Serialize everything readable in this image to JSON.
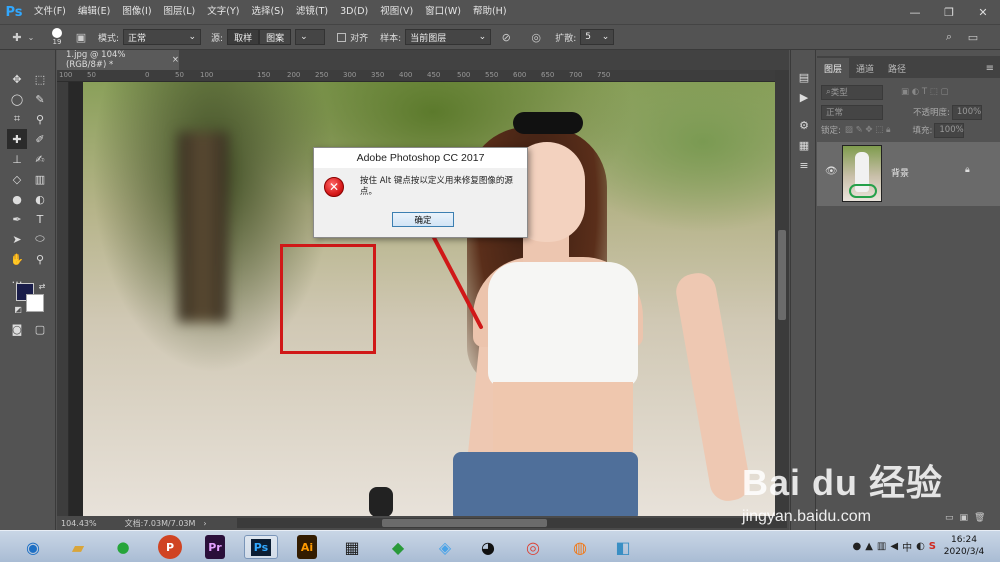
{
  "app": {
    "logo": "Ps"
  },
  "menu": [
    "文件(F)",
    "编辑(E)",
    "图像(I)",
    "图层(L)",
    "文字(Y)",
    "选择(S)",
    "滤镜(T)",
    "3D(D)",
    "视图(V)",
    "窗口(W)",
    "帮助(H)"
  ],
  "window_controls": {
    "minimize": "—",
    "maximize": "❐",
    "close": "✕"
  },
  "options": {
    "brush_size": "19",
    "mode_label": "模式:",
    "mode_value": "正常",
    "source_label": "源:",
    "sample_btn": "取样",
    "pattern_btn": "图案",
    "align_label": "对齐",
    "sample_label": "样本:",
    "sample_value": "当前图层",
    "diffusion_label": "扩散:",
    "diffusion_value": "5"
  },
  "document": {
    "tab_title": "1.jpg @ 104%(RGB/8#) *",
    "tab_close": "×"
  },
  "ruler_top": [
    "100",
    "50",
    "0",
    "50",
    "100",
    "150",
    "200",
    "250",
    "300",
    "350",
    "400",
    "450",
    "500",
    "550",
    "600",
    "650",
    "700",
    "750"
  ],
  "dialog": {
    "title": "Adobe Photoshop CC 2017",
    "message": "按住 Alt 键点按以定义用来修复图像的源点。",
    "ok_button": "确定",
    "icon": "error-icon"
  },
  "status": {
    "zoom": "104.43%",
    "doc_info": "文档:7.03M/7.03M"
  },
  "layers_panel": {
    "tabs": [
      "图层",
      "通道",
      "路径"
    ],
    "filter_label": "类型",
    "blend_mode": "正常",
    "opacity_label": "不透明度:",
    "opacity_value": "100%",
    "lock_label": "锁定:",
    "fill_label": "填充:",
    "fill_value": "100%",
    "layer_name": "背景"
  },
  "taskbar": {
    "apps": [
      "ie",
      "folder",
      "wechat",
      "powerpoint",
      "premiere",
      "photoshop",
      "illustrator",
      "video",
      "browser-app",
      "tool",
      "qq",
      "chrome",
      "firefox",
      "notepad"
    ],
    "clock_time": "16:24",
    "clock_date": "2020/3/4"
  },
  "watermark": {
    "logo": "Bai du 经验",
    "url": "jingyan.baidu.com"
  }
}
